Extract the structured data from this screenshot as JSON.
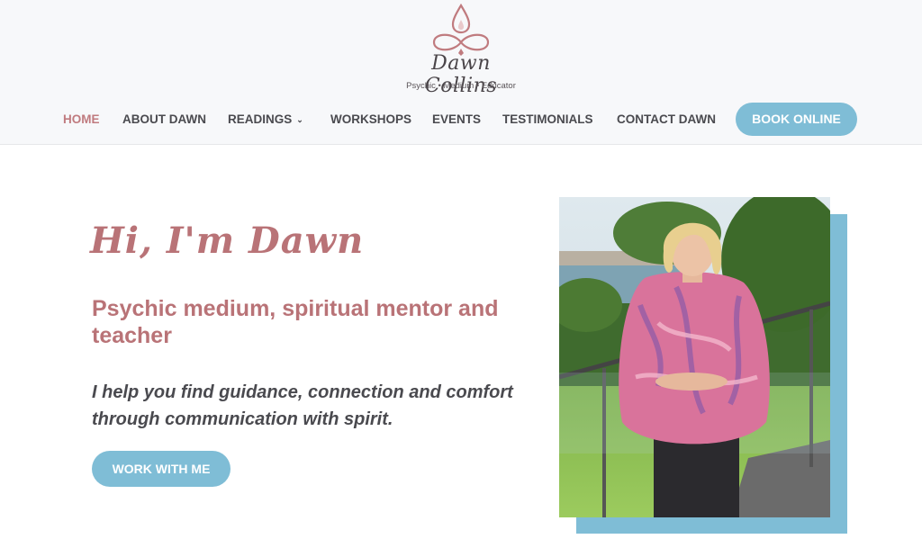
{
  "brand": {
    "name": "Dawn Collins",
    "tagline": "Psychic • Medium • Educator",
    "accent_color": "#b97377",
    "button_color": "#7fbdd6"
  },
  "nav": {
    "items": [
      {
        "label": "HOME",
        "active": true
      },
      {
        "label": "ABOUT DAWN"
      },
      {
        "label": "READINGS",
        "has_dropdown": true
      },
      {
        "label": "WORKSHOPS"
      },
      {
        "label": "EVENTS"
      },
      {
        "label": "TESTIMONIALS"
      },
      {
        "label": "CONTACT DAWN"
      }
    ],
    "cta_label": "BOOK ONLINE"
  },
  "hero": {
    "title": "Hi, I'm Dawn",
    "subtitle": "Psychic medium, spiritual mentor and teacher",
    "text": "I help you find guidance, connection and comfort through communication with spirit.",
    "cta_label": "WORK WITH ME"
  }
}
